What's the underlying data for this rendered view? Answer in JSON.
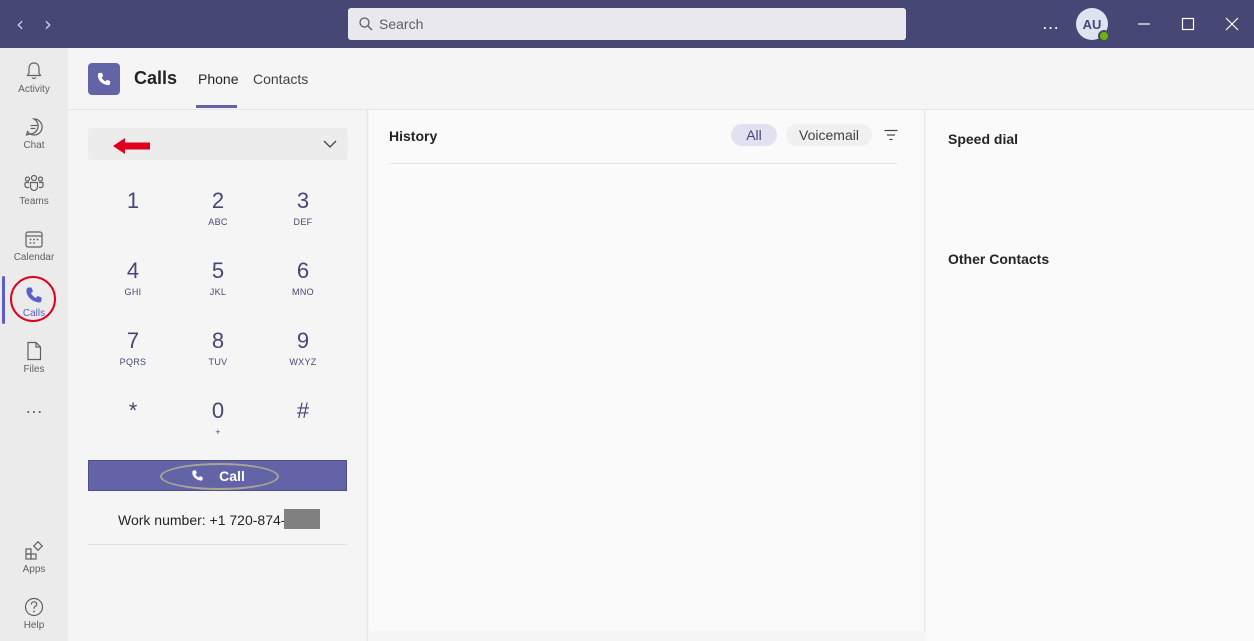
{
  "titlebar": {
    "search_placeholder": "Search",
    "avatar_initials": "AU",
    "more_label": "…"
  },
  "rail": {
    "items": [
      {
        "label": "Activity"
      },
      {
        "label": "Chat"
      },
      {
        "label": "Teams"
      },
      {
        "label": "Calendar"
      },
      {
        "label": "Calls"
      },
      {
        "label": "Files"
      },
      {
        "label": "Apps"
      },
      {
        "label": "Help"
      }
    ],
    "more_label": "…"
  },
  "header": {
    "title": "Calls",
    "tabs": [
      {
        "label": "Phone",
        "active": true
      },
      {
        "label": "Contacts",
        "active": false
      }
    ]
  },
  "dialpad": {
    "keys": [
      {
        "num": "1",
        "sub": ""
      },
      {
        "num": "2",
        "sub": "ABC"
      },
      {
        "num": "3",
        "sub": "DEF"
      },
      {
        "num": "4",
        "sub": "GHI"
      },
      {
        "num": "5",
        "sub": "JKL"
      },
      {
        "num": "6",
        "sub": "MNO"
      },
      {
        "num": "7",
        "sub": "PQRS"
      },
      {
        "num": "8",
        "sub": "TUV"
      },
      {
        "num": "9",
        "sub": "WXYZ"
      },
      {
        "num": "*",
        "sub": ""
      },
      {
        "num": "0",
        "sub": "+"
      },
      {
        "num": "#",
        "sub": ""
      }
    ],
    "call_label": "Call",
    "work_number_label": "Work number: +1 720-874-"
  },
  "history": {
    "title": "History",
    "filters": [
      {
        "label": "All",
        "active": true
      },
      {
        "label": "Voicemail",
        "active": false
      }
    ]
  },
  "speed": {
    "speed_dial_title": "Speed dial",
    "other_contacts_title": "Other Contacts"
  },
  "colors": {
    "titlebar": "#464775",
    "accent": "#6264a7",
    "annotation_red": "#e0001b"
  }
}
